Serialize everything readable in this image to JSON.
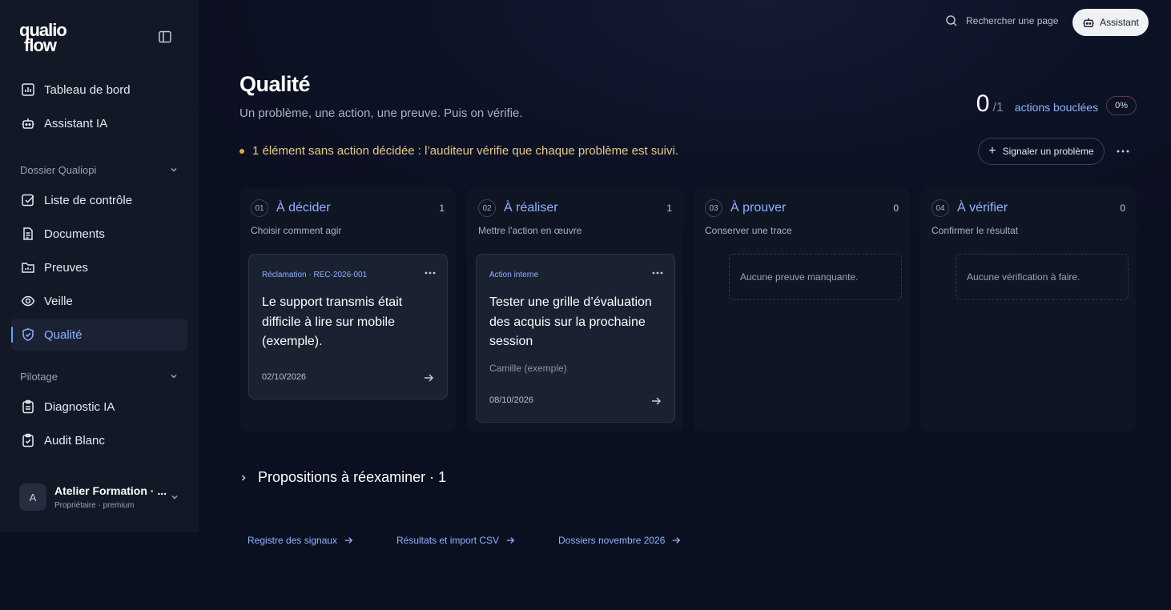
{
  "brand": {
    "logo_line1": "qualio",
    "logo_line2": "flow"
  },
  "sidebar": {
    "items_top": [
      {
        "label": "Tableau de bord",
        "icon": "chart-icon"
      },
      {
        "label": "Assistant IA",
        "icon": "robot-icon"
      }
    ],
    "section1": {
      "label": "Dossier Qualiopi"
    },
    "items_dossier": [
      {
        "label": "Liste de contrôle",
        "icon": "checkbox-icon"
      },
      {
        "label": "Documents",
        "icon": "document-icon"
      },
      {
        "label": "Preuves",
        "icon": "folder-icon"
      },
      {
        "label": "Veille",
        "icon": "eye-icon"
      },
      {
        "label": "Qualité",
        "icon": "shield-check-icon",
        "active": true
      }
    ],
    "section2": {
      "label": "Pilotage"
    },
    "items_pilotage": [
      {
        "label": "Diagnostic IA",
        "icon": "clipboard-icon"
      },
      {
        "label": "Audit Blanc",
        "icon": "clipboard-check-icon"
      }
    ],
    "account": {
      "initial": "A",
      "name": "Atelier Formation · ...",
      "role": "Propriétaire · premium"
    }
  },
  "topbar": {
    "search_label": "Rechercher une page",
    "assistant_label": "Assistant"
  },
  "header": {
    "title": "Qualité",
    "subtitle": "Un problème, une action, une preuve. Puis on vérifie.",
    "closed_count": "0",
    "closed_total": "/1",
    "closed_label": "actions bouclées",
    "closed_pct": "0%",
    "closed_fraction": 0,
    "warning": "1 élément sans action décidée : l’auditeur vérifie que chaque problème est suivi.",
    "signal_label": "Signaler un problème"
  },
  "columns": [
    {
      "num": "01",
      "title": "À décider",
      "count": "1",
      "subtitle": "Choisir comment agir",
      "card": {
        "tag": "Réclamation · REC-2026-001",
        "title": "Le support transmis était difficile à lire sur mobile (exemple).",
        "meta": "",
        "date": "02/10/2026"
      }
    },
    {
      "num": "02",
      "title": "À réaliser",
      "count": "1",
      "subtitle": "Mettre l’action en œuvre",
      "card": {
        "tag": "Action interne",
        "title": "Tester une grille d’évaluation des acquis sur la prochaine session",
        "meta": "Camille (exemple)",
        "date": "08/10/2026"
      }
    },
    {
      "num": "03",
      "title": "À prouver",
      "count": "0",
      "subtitle": "Conserver une trace",
      "empty": "Aucune preuve manquante."
    },
    {
      "num": "04",
      "title": "À vérifier",
      "count": "0",
      "subtitle": "Confirmer le résultat",
      "empty": "Aucune vérification à faire."
    }
  ],
  "proposals": {
    "label": "Propositions à réexaminer · 1"
  },
  "footer_links": [
    {
      "label": "Registre des signaux"
    },
    {
      "label": "Résultats et import CSV"
    },
    {
      "label": "Dossiers novembre 2026"
    }
  ],
  "colors": {
    "accent": "#8fb3ff",
    "warning": "#e4a64a",
    "background": "#0b1020",
    "sidebar": "#121826"
  }
}
